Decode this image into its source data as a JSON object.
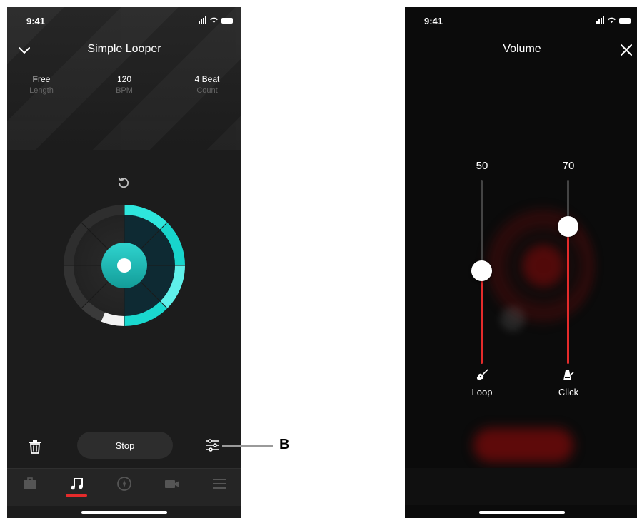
{
  "left_screen": {
    "status": {
      "time": "9:41"
    },
    "header": {
      "title": "Simple Looper",
      "back_icon": "chevron-down-icon"
    },
    "info": [
      {
        "value": "Free",
        "label": "Length"
      },
      {
        "value": "120",
        "label": "BPM"
      },
      {
        "value": "4 Beat",
        "label": "Count"
      }
    ],
    "reload_icon": "undo-icon",
    "dial": {
      "accent": "#1ee0d6",
      "progress_segments_filled": 6,
      "total_segments": 8
    },
    "controls": {
      "stop_label": "Stop",
      "trash_icon": "trash-icon",
      "settings_icon": "sliders-icon"
    },
    "tabs": [
      {
        "icon": "briefcase-icon",
        "active": false
      },
      {
        "icon": "music-note-icon",
        "active": true
      },
      {
        "icon": "compass-icon",
        "active": false
      },
      {
        "icon": "video-camera-icon",
        "active": false
      },
      {
        "icon": "menu-icon",
        "active": false
      }
    ],
    "tab_active_color": "#e52b2b"
  },
  "callout": {
    "label": "B"
  },
  "right_screen": {
    "status": {
      "time": "9:41"
    },
    "header": {
      "title": "Volume",
      "close_icon": "close-icon"
    },
    "sliders": [
      {
        "value": "50",
        "level_percent": 50,
        "name": "Loop",
        "icon": "guitar-icon"
      },
      {
        "value": "70",
        "level_percent": 70,
        "name": "Click",
        "icon": "metronome-icon"
      }
    ],
    "accent": "#e52b2b"
  }
}
